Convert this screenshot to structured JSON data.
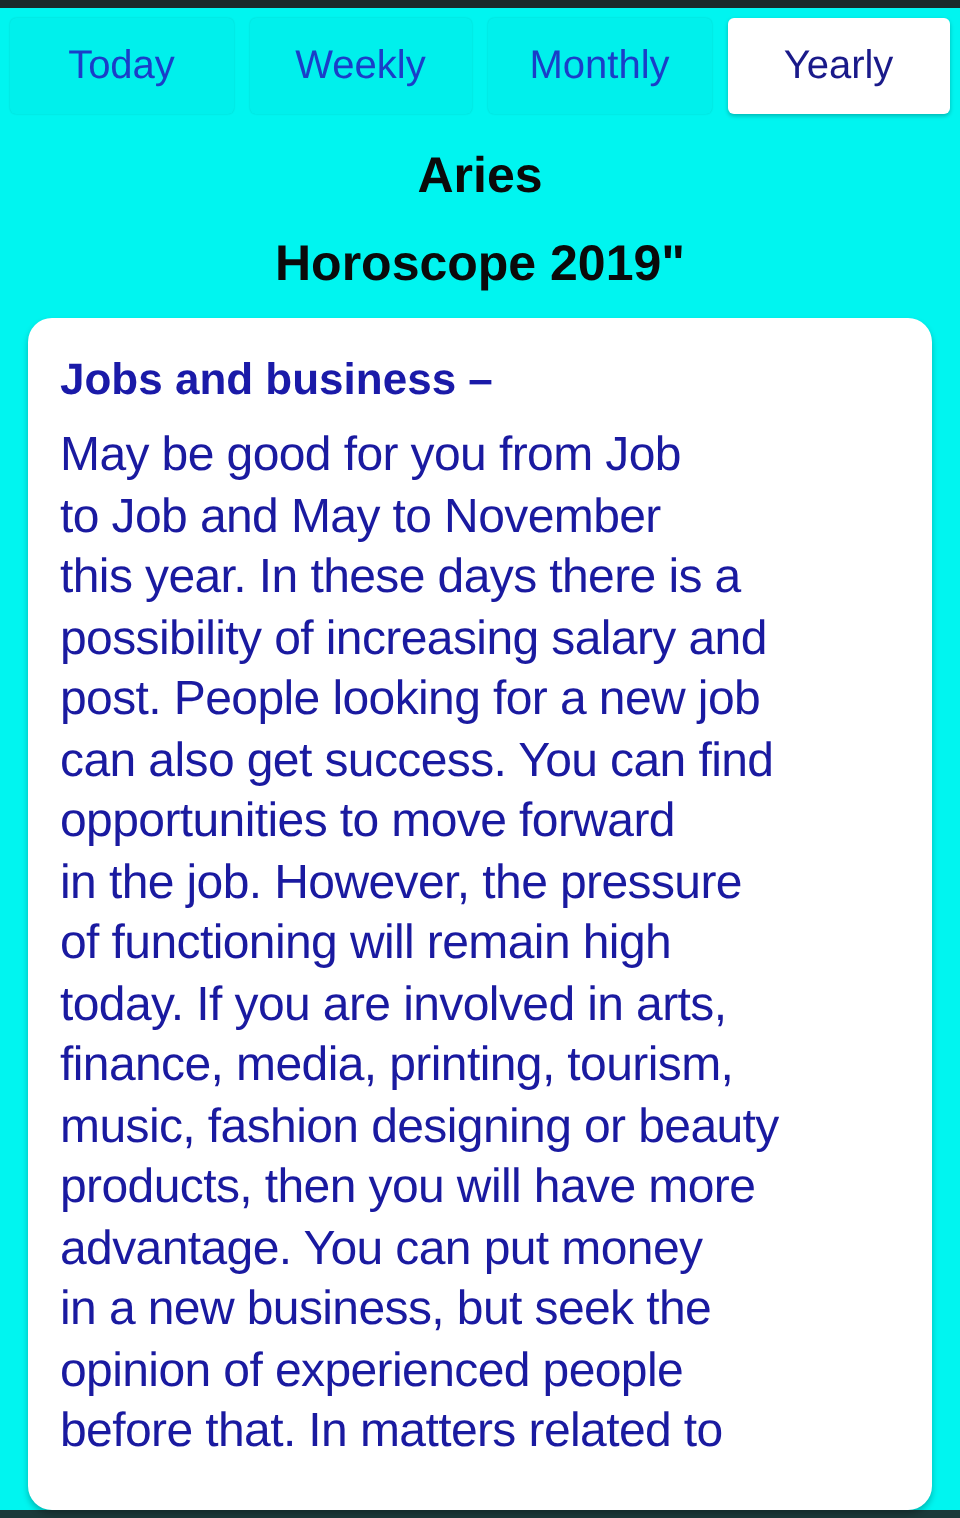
{
  "tabs": [
    {
      "label": "Today",
      "selected": false
    },
    {
      "label": "Weekly",
      "selected": false
    },
    {
      "label": "Monthly",
      "selected": false
    },
    {
      "label": "Yearly",
      "selected": true
    }
  ],
  "title_lines": [
    "Aries",
    "Horoscope 2019\""
  ],
  "card": {
    "heading": "Jobs and business –",
    "body_lines": [
      "May be good for you from Job",
      "to Job and May to November",
      "this year. In these days there is a",
      "possibility of increasing salary and",
      "post. People looking for a new job",
      "can also get success. You can find",
      "opportunities to move forward",
      "in the job. However, the pressure",
      "of functioning will remain high",
      "today. If you are involved in arts,",
      "finance, media, printing, tourism,",
      "music, fashion designing or beauty",
      "products, then you will have more",
      "advantage. You can put money",
      "in a new business, but seek the",
      "opinion of experienced people",
      "before that. In matters related to"
    ]
  }
}
